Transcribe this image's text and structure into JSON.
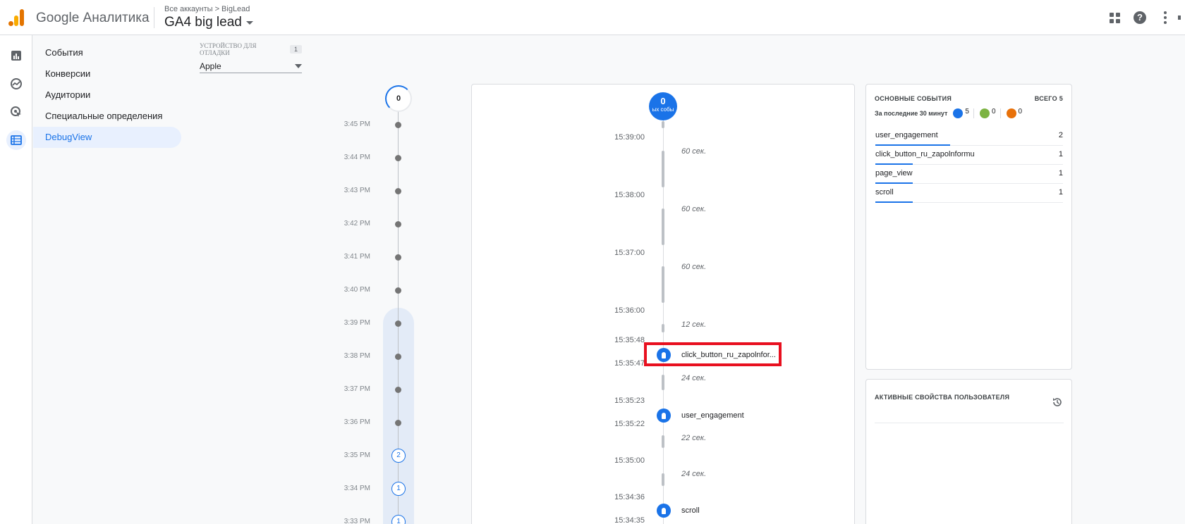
{
  "header": {
    "brand": "Google Аналитика",
    "breadcrumbs": "Все аккаунты > BigLead",
    "property": "GA4 big lead"
  },
  "nav": {
    "items": [
      {
        "label": "События"
      },
      {
        "label": "Конверсии"
      },
      {
        "label": "Аудитории"
      },
      {
        "label": "Специальные определения"
      },
      {
        "label": "DebugView",
        "active": true
      }
    ]
  },
  "device": {
    "label": "Устройство для отладки",
    "count": "1",
    "value": "Apple"
  },
  "minutes": {
    "top_count": "0",
    "rows": [
      {
        "time": "3:45 PM"
      },
      {
        "time": "3:44 PM"
      },
      {
        "time": "3:43 PM"
      },
      {
        "time": "3:42 PM"
      },
      {
        "time": "3:41 PM"
      },
      {
        "time": "3:40 PM"
      },
      {
        "time": "3:39 PM"
      },
      {
        "time": "3:38 PM"
      },
      {
        "time": "3:37 PM"
      },
      {
        "time": "3:36 PM"
      },
      {
        "time": "3:35 PM",
        "count": "2"
      },
      {
        "time": "3:34 PM",
        "count": "1"
      },
      {
        "time": "3:33 PM",
        "count": "1"
      }
    ]
  },
  "stream": {
    "top_count": "0",
    "top_label": "ых собы",
    "timestamps": [
      "15:39:00",
      "15:38:00",
      "15:37:00",
      "15:36:00",
      "15:35:48",
      "15:35:47",
      "15:35:23",
      "15:35:22",
      "15:35:00",
      "15:34:36",
      "15:34:35"
    ],
    "gaps": [
      "60 сек.",
      "60 сек.",
      "60 сек.",
      "12 сек.",
      "24 сек.",
      "22 сек.",
      "24 сек."
    ],
    "events": [
      {
        "name": "click_button_ru_zapolnfor...",
        "highlighted": true
      },
      {
        "name": "user_engagement"
      },
      {
        "name": "scroll"
      }
    ]
  },
  "top_events": {
    "title": "Основные события",
    "total": "ВСЕГО 5",
    "period": "За последние 30 минут",
    "legend": [
      {
        "icon": "touch-icon",
        "color": "#1a73e8",
        "value": "5"
      },
      {
        "icon": "flag-icon",
        "color": "#7cb342",
        "value": "0"
      },
      {
        "icon": "bug-icon",
        "color": "#e8710a",
        "value": "0"
      }
    ],
    "rows": [
      {
        "name": "user_engagement",
        "count": "2",
        "share": 0.4
      },
      {
        "name": "click_button_ru_zapolnformu",
        "count": "1",
        "share": 0.2
      },
      {
        "name": "page_view",
        "count": "1",
        "share": 0.2
      },
      {
        "name": "scroll",
        "count": "1",
        "share": 0.2
      }
    ]
  },
  "user_props": {
    "title": "Активные свойства пользователя"
  }
}
